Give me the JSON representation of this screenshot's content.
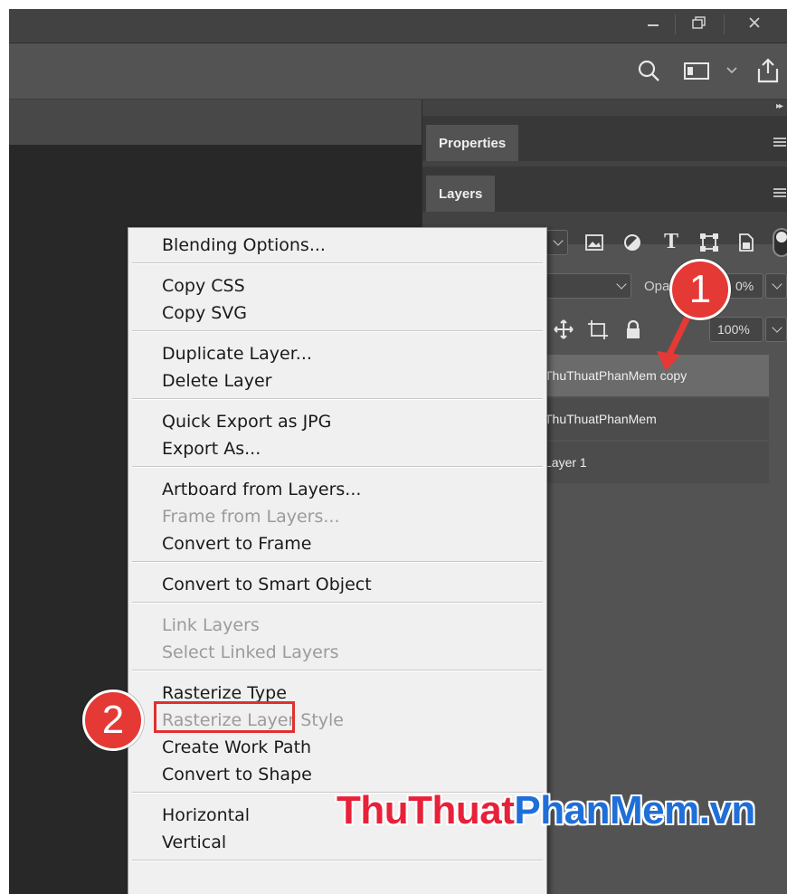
{
  "panels": {
    "properties": {
      "tab_label": "Properties"
    },
    "layers": {
      "tab_label": "Layers",
      "blend_mode": "",
      "opacity_label": "Opa",
      "opacity_value": "0%",
      "fill_value": "100%",
      "rows": [
        {
          "name": "ThuThuatPhanMem copy"
        },
        {
          "name": "ThuThuatPhanMem"
        },
        {
          "name": "Layer 1"
        }
      ]
    }
  },
  "context_menu": {
    "groups": [
      [
        {
          "label": "Blending Options...",
          "enabled": true
        }
      ],
      [
        {
          "label": "Copy CSS",
          "enabled": true
        },
        {
          "label": "Copy SVG",
          "enabled": true
        }
      ],
      [
        {
          "label": "Duplicate Layer...",
          "enabled": true
        },
        {
          "label": "Delete Layer",
          "enabled": true
        }
      ],
      [
        {
          "label": "Quick Export as JPG",
          "enabled": true
        },
        {
          "label": "Export As...",
          "enabled": true
        }
      ],
      [
        {
          "label": "Artboard from Layers...",
          "enabled": true
        },
        {
          "label": "Frame from Layers...",
          "enabled": false
        },
        {
          "label": "Convert to Frame",
          "enabled": true
        }
      ],
      [
        {
          "label": "Convert to Smart Object",
          "enabled": true
        }
      ],
      [
        {
          "label": "Link Layers",
          "enabled": false
        },
        {
          "label": "Select Linked Layers",
          "enabled": false
        }
      ],
      [
        {
          "label": "Rasterize Type",
          "enabled": true
        },
        {
          "label": "Rasterize Layer Style",
          "enabled": false
        },
        {
          "label": "Create Work Path",
          "enabled": true
        },
        {
          "label": "Convert to Shape",
          "enabled": true
        }
      ],
      [
        {
          "label": "Horizontal",
          "enabled": true
        },
        {
          "label": "Vertical",
          "enabled": true
        }
      ]
    ]
  },
  "annotations": {
    "step1": "1",
    "step2": "2"
  },
  "watermark": {
    "part1": "ThuThuat",
    "part2": "PhanMem",
    "part3": ".vn",
    "color1": "#e8213a",
    "color2": "#1f6fd8"
  },
  "colors": {
    "highlight": "#e03030",
    "badge": "#e53935"
  }
}
